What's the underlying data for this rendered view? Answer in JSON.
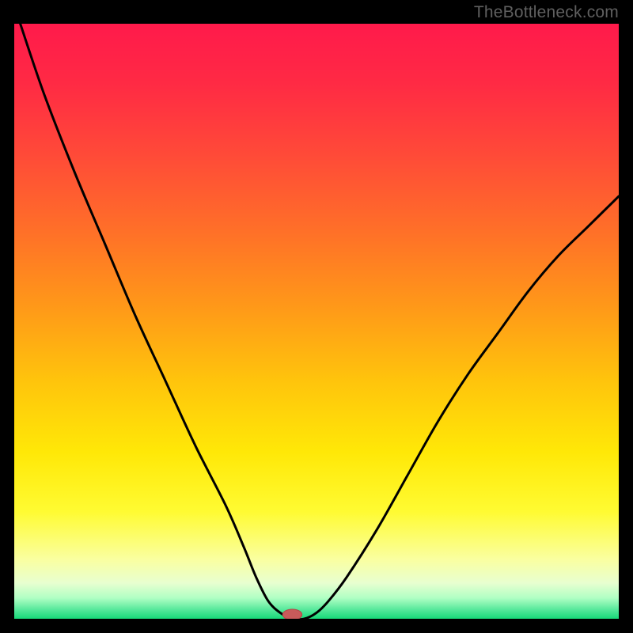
{
  "watermark": "TheBottleneck.com",
  "colors": {
    "stroke": "#000000",
    "marker_fill": "#c85a5a",
    "marker_stroke": "#b24848",
    "gradient_stops": [
      {
        "offset": 0.0,
        "color": "#ff1a4b"
      },
      {
        "offset": 0.1,
        "color": "#ff2a44"
      },
      {
        "offset": 0.22,
        "color": "#ff4a38"
      },
      {
        "offset": 0.35,
        "color": "#ff7028"
      },
      {
        "offset": 0.48,
        "color": "#ff9a18"
      },
      {
        "offset": 0.6,
        "color": "#ffc40c"
      },
      {
        "offset": 0.72,
        "color": "#ffe807"
      },
      {
        "offset": 0.82,
        "color": "#fffb32"
      },
      {
        "offset": 0.9,
        "color": "#faffa0"
      },
      {
        "offset": 0.94,
        "color": "#e8ffd0"
      },
      {
        "offset": 0.965,
        "color": "#b0ffc4"
      },
      {
        "offset": 0.985,
        "color": "#55e89a"
      },
      {
        "offset": 1.0,
        "color": "#17d978"
      }
    ]
  },
  "chart_data": {
    "type": "line",
    "title": "",
    "xlabel": "",
    "ylabel": "",
    "xlim": [
      0,
      100
    ],
    "ylim": [
      0,
      100
    ],
    "grid": false,
    "legend": false,
    "series": [
      {
        "name": "bottleneck-curve",
        "x": [
          1,
          5,
          10,
          15,
          20,
          25,
          30,
          35,
          38,
          40,
          42,
          44,
          46,
          48,
          50,
          52,
          55,
          60,
          65,
          70,
          75,
          80,
          85,
          90,
          95,
          100
        ],
        "values": [
          100,
          88,
          75,
          63,
          51,
          40,
          29,
          19,
          12,
          7,
          3,
          1,
          0,
          0,
          1,
          3,
          7,
          15,
          24,
          33,
          41,
          48,
          55,
          61,
          66,
          71
        ]
      }
    ],
    "flat_bottom": {
      "x_start": 44,
      "x_end": 48,
      "y": 0
    },
    "marker": {
      "x": 46,
      "y": 0.7,
      "rx": 1.6,
      "ry": 0.9
    }
  }
}
